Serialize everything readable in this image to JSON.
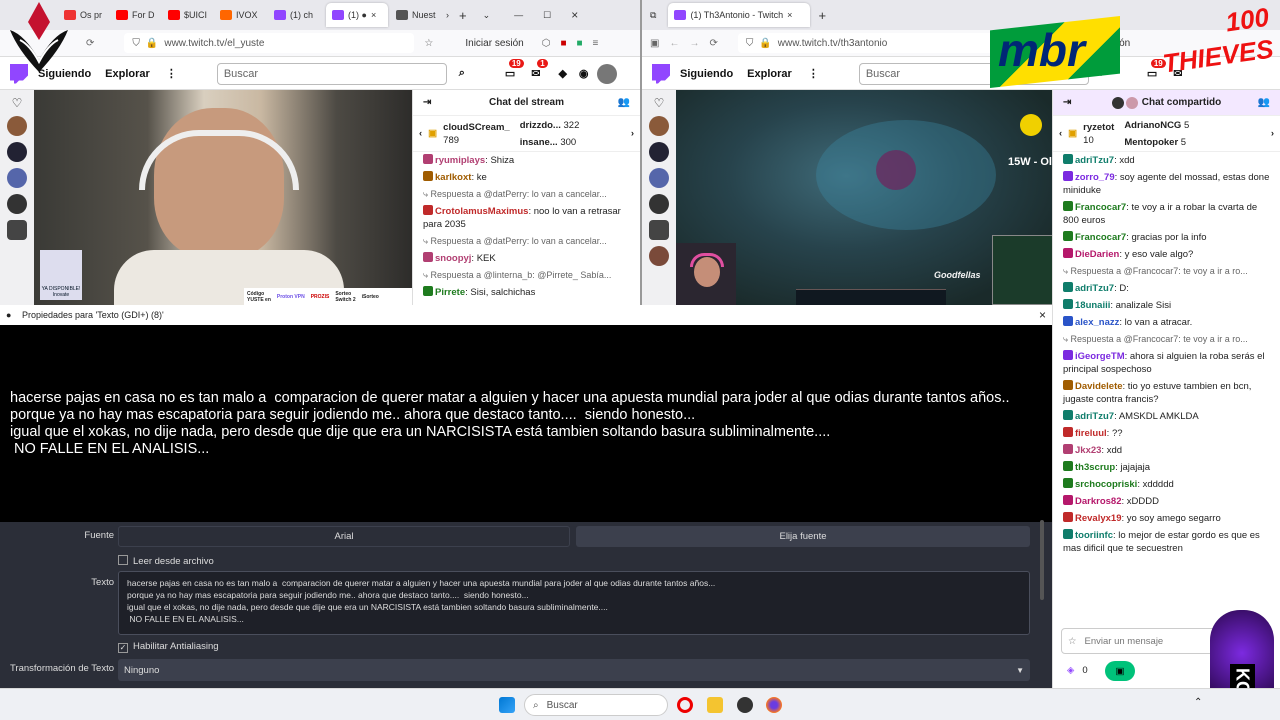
{
  "left_browser": {
    "tabs": [
      "Os pr",
      "For D",
      "$UICI",
      "IVOX",
      "(1) ch",
      "(1) ●",
      "Nuest"
    ],
    "url": "www.twitch.tv/el_yuste",
    "signin": "Iniciar sesión",
    "nav": {
      "following": "Siguiendo",
      "explore": "Explorar",
      "search_placeholder": "Buscar",
      "notif_count": "19",
      "inbox_count": "1"
    },
    "video_overlay": {
      "card_line1": "YA DISPONIBLE!",
      "card_line2": "Inovate",
      "promo_prefix": "Código",
      "promo_code": "YUSTE en",
      "sponsors": [
        "Proton VPN",
        "PROZIS"
      ],
      "giveaway_line1": "Sorteo",
      "giveaway_line2": "Switch 2",
      "giveaway_label": "iSorteo"
    },
    "chat": {
      "title": "Chat del stream",
      "gifts": [
        {
          "user": "cloudSCream_",
          "count": "789"
        },
        {
          "user": "drizzdo...",
          "count": "322"
        },
        {
          "user": "insane...",
          "count": "300"
        }
      ],
      "messages": [
        {
          "user": "ryumiplays",
          "text": ": Shiza",
          "color": "#b13f72"
        },
        {
          "user": "karlkoxt",
          "text": ": ke",
          "color": "#a05c00"
        },
        {
          "reply": "Respuesta a @datPerry: lo van a cancelar..."
        },
        {
          "user": "CrotolamusMaximus",
          "text": ": noo lo van a retrasar para 2035",
          "color": "#c02a2a"
        },
        {
          "reply": "Respuesta a @datPerry: lo van a cancelar..."
        },
        {
          "user": "snoopyj",
          "text": ": KEK",
          "color": "#b13f72"
        },
        {
          "reply": "Respuesta a @linterna_b: @Pirrete_ Sabía..."
        },
        {
          "user": "Pirrete",
          "text": ": Sisi, salchichas",
          "color": "#1e7b1e"
        }
      ]
    }
  },
  "right_browser": {
    "tab_title": "(1) Th3Antonio - Twitch",
    "url": "www.twitch.tv/th3antonio",
    "signin": "Iniciar sesión",
    "nav": {
      "following": "Siguiendo",
      "explore": "Explorar",
      "search_placeholder": "Buscar",
      "notif_count": "19"
    },
    "game_overlay": {
      "wins": "15W - Ol",
      "watermark": "Goodfellas"
    },
    "chat": {
      "title": "Chat compartido",
      "gifts": [
        {
          "user": "ryzetot",
          "count": "10"
        },
        {
          "user": "AdrianoNCG",
          "count": "5"
        },
        {
          "user": "Mentopoker",
          "count": "5"
        }
      ],
      "messages": [
        {
          "user": "adriTzu7",
          "text": ": xdd",
          "color": "#0f7d6b"
        },
        {
          "user": "zorro_79",
          "text": ": soy agente del mossad, estas done miniduke",
          "color": "#7b2ae0"
        },
        {
          "user": "Francocar7",
          "text": ": te voy a ir a robar la cvarta de 800 euros",
          "color": "#1e7b1e"
        },
        {
          "user": "Francocar7",
          "text": ": gracias por la info",
          "color": "#1e7b1e"
        },
        {
          "user": "DieDarien",
          "text": ": y eso vale algo?",
          "color": "#b5186b"
        },
        {
          "reply": "Respuesta a @Francocar7: te voy a ir a ro..."
        },
        {
          "user": "adriTzu7",
          "text": ": D:",
          "color": "#0f7d6b"
        },
        {
          "user": "18unaiii",
          "text": ": analizale Sisi",
          "color": "#0f7d6b"
        },
        {
          "user": "alex_nazz",
          "text": ": lo van a atracar.",
          "color": "#2a54c8"
        },
        {
          "reply": "Respuesta a @Francocar7: te voy a ir a ro..."
        },
        {
          "user": "iGeorgeTM",
          "text": ": ahora si alguien la roba serás el principal sospechoso",
          "color": "#7b2ae0"
        },
        {
          "user": "Davidelete",
          "text": ": tio yo estuve tambien en bcn, jugaste contra francis?",
          "color": "#a05c00"
        },
        {
          "user": "adriTzu7",
          "text": ": AMSKDL AMKLDA",
          "color": "#0f7d6b"
        },
        {
          "user": "fireluul",
          "text": ": ??",
          "color": "#c02a2a"
        },
        {
          "user": "Jkx23",
          "text": ": xdd",
          "color": "#b13f72"
        },
        {
          "user": "th3scrup",
          "text": ": jajajaja",
          "color": "#1e7b1e"
        },
        {
          "user": "srchocopriski",
          "text": ": xddddd",
          "color": "#1e7b1e"
        },
        {
          "user": "Darkros82",
          "text": ": xDDDD",
          "color": "#b5186b"
        },
        {
          "user": "Revalyx19",
          "text": ": yo soy amego segarro",
          "color": "#c02a2a"
        },
        {
          "user": "tooriinfc",
          "text": ": lo mejor de estar gordo es que es mas dificil que te secuestren",
          "color": "#0f7d6b"
        }
      ],
      "input_placeholder": "Enviar un mensaje",
      "points": "0"
    }
  },
  "overlay_logos": {
    "mbr": "mbr",
    "thieves": "100 THIEVES",
    "koi": "KOI"
  },
  "obs": {
    "dialog_title": "Propiedades para 'Texto (GDI+) (8)'",
    "preview_lines": [
      "hacerse pajas en casa no es tan malo a  comparacion de querer matar a alguien y hacer una apuesta mundial para joder al que odias durante tantos años..",
      "porque ya no hay mas escapatoria para seguir jodiendo me.. ahora que destaco tanto....  siendo honesto...",
      "igual que el xokas, no dije nada, pero desde que dije que era un NARCISISTA está tambien soltando basura subliminalmente....",
      " NO FALLE EN EL ANALISIS..."
    ],
    "font_label": "Fuente",
    "font_value": "Arial",
    "font_button": "Elija fuente",
    "read_file_label": "Leer desde archivo",
    "text_label": "Texto",
    "text_lines": [
      "hacerse pajas en casa no es tan malo a  comparacion de querer matar a alguien y hacer una apuesta mundial para joder al que odias durante tantos años...",
      "porque ya no hay mas escapatoria para seguir jodiendo me.. ahora que destaco tanto....  siendo honesto...",
      "igual que el xokas, no dije nada, pero desde que dije que era un NARCISISTA está tambien soltando basura subliminalmente....",
      " NO FALLE EN EL ANALISIS..."
    ],
    "antialias_label": "Habilitar Antialiasing",
    "transform_label": "Transformación de Texto",
    "transform_value": "Ninguno"
  },
  "taskbar": {
    "search_placeholder": "Buscar"
  },
  "colors": {
    "twitch_purple": "#9146ff",
    "obs_bg": "#2b2e38",
    "obs_control": "#3c404d"
  }
}
